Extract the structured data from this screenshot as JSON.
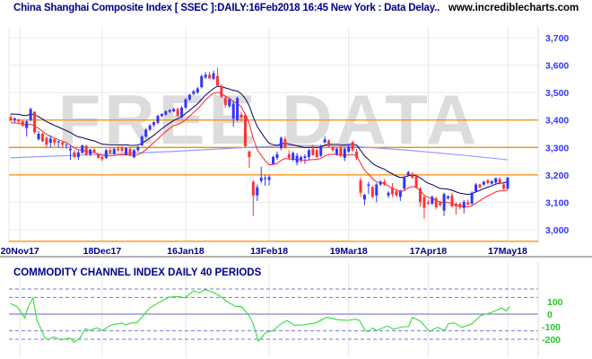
{
  "header": {
    "title": "China Shanghai Composite Index [ SSEC ]:DAILY:16Feb2018 16:45 New York : Data Delay..",
    "site": "www.incrediblecharts.com"
  },
  "watermark": "FREE DATA",
  "colors": {
    "up": "#3333ff",
    "down": "#ff3333",
    "fast_band": "#ff2222",
    "slow_band": "#000066",
    "long_ma": "#9999ff",
    "level": "#ff8800",
    "cci": "#33dd33",
    "axis_price": "#3333ff",
    "axis_cci": "#22cc22",
    "title": "#00008b"
  },
  "chart_data": [
    {
      "type": "candlestick",
      "title": "China Shanghai Composite Index [ SSEC ] DAILY",
      "ylim": [
        2940,
        3760
      ],
      "y_ticks": [
        {
          "v": 3000,
          "label": "3,000"
        },
        {
          "v": 3100,
          "label": "3,100"
        },
        {
          "v": 3200,
          "label": "3,200"
        },
        {
          "v": 3300,
          "label": "3,300"
        },
        {
          "v": 3400,
          "label": "3,400"
        },
        {
          "v": 3500,
          "label": "3,500"
        },
        {
          "v": 3600,
          "label": "3,600"
        },
        {
          "v": 3700,
          "label": "3,700"
        }
      ],
      "x_ticks": [
        {
          "day": 2.3,
          "label": "20Nov17"
        },
        {
          "day": 23,
          "label": "18Dec17"
        },
        {
          "day": 44,
          "label": "16Jan18"
        },
        {
          "day": 65,
          "label": "13Feb18"
        },
        {
          "day": 85,
          "label": "19Mar18"
        },
        {
          "day": 105,
          "label": "17Apr18"
        },
        {
          "day": 125,
          "label": "17May18"
        }
      ],
      "levels": [
        3400,
        3300,
        3200,
        2958
      ],
      "band_period": 13,
      "long_ma": [
        [
          0,
          3262
        ],
        [
          40,
          3285
        ],
        [
          70,
          3308
        ],
        [
          85,
          3305
        ],
        [
          100,
          3290
        ],
        [
          115,
          3270
        ],
        [
          125,
          3255
        ]
      ],
      "ohlc": [
        [
          3410,
          3420,
          3395,
          3400
        ],
        [
          3400,
          3410,
          3390,
          3405
        ],
        [
          3400,
          3405,
          3385,
          3395
        ],
        [
          3395,
          3400,
          3375,
          3380
        ],
        [
          3370,
          3400,
          3340,
          3395
        ],
        [
          3400,
          3445,
          3395,
          3440
        ],
        [
          3430,
          3432,
          3350,
          3355
        ],
        [
          3330,
          3360,
          3325,
          3350
        ],
        [
          3350,
          3355,
          3320,
          3322
        ],
        [
          3335,
          3340,
          3300,
          3310
        ],
        [
          3318,
          3345,
          3300,
          3332
        ],
        [
          3330,
          3335,
          3305,
          3318
        ],
        [
          3318,
          3325,
          3300,
          3322
        ],
        [
          3318,
          3320,
          3300,
          3310
        ],
        [
          3308,
          3312,
          3295,
          3311
        ],
        [
          3290,
          3310,
          3255,
          3295
        ],
        [
          3282,
          3290,
          3262,
          3265
        ],
        [
          3265,
          3290,
          3255,
          3282
        ],
        [
          3280,
          3310,
          3278,
          3308
        ],
        [
          3306,
          3310,
          3270,
          3272
        ],
        [
          3275,
          3295,
          3268,
          3292
        ],
        [
          3292,
          3296,
          3280,
          3283
        ],
        [
          3275,
          3280,
          3260,
          3262
        ],
        [
          3265,
          3268,
          3250,
          3257
        ],
        [
          3262,
          3295,
          3258,
          3290
        ],
        [
          3290,
          3300,
          3275,
          3280
        ],
        [
          3278,
          3300,
          3270,
          3295
        ],
        [
          3296,
          3305,
          3285,
          3290
        ],
        [
          3298,
          3305,
          3282,
          3288
        ],
        [
          3275,
          3300,
          3270,
          3298
        ],
        [
          3295,
          3300,
          3268,
          3272
        ],
        [
          3265,
          3295,
          3260,
          3290
        ],
        [
          3290,
          3305,
          3285,
          3302
        ],
        [
          3308,
          3345,
          3305,
          3340
        ],
        [
          3340,
          3370,
          3335,
          3365
        ],
        [
          3365,
          3385,
          3360,
          3380
        ],
        [
          3382,
          3395,
          3375,
          3392
        ],
        [
          3390,
          3420,
          3385,
          3415
        ],
        [
          3415,
          3425,
          3410,
          3422
        ],
        [
          3420,
          3435,
          3415,
          3432
        ],
        [
          3430,
          3440,
          3425,
          3436
        ],
        [
          3432,
          3445,
          3428,
          3440
        ],
        [
          3440,
          3445,
          3410,
          3415
        ],
        [
          3410,
          3450,
          3405,
          3445
        ],
        [
          3445,
          3480,
          3440,
          3475
        ],
        [
          3475,
          3495,
          3470,
          3492
        ],
        [
          3495,
          3510,
          3490,
          3505
        ],
        [
          3500,
          3520,
          3495,
          3515
        ],
        [
          3520,
          3565,
          3515,
          3560
        ],
        [
          3555,
          3575,
          3550,
          3565
        ],
        [
          3565,
          3575,
          3550,
          3552
        ],
        [
          3550,
          3580,
          3545,
          3570
        ],
        [
          3560,
          3590,
          3520,
          3525
        ],
        [
          3525,
          3530,
          3480,
          3485
        ],
        [
          3480,
          3490,
          3445,
          3455
        ],
        [
          3450,
          3480,
          3445,
          3475
        ],
        [
          3405,
          3470,
          3375,
          3460
        ],
        [
          3400,
          3485,
          3395,
          3480
        ],
        [
          3420,
          3430,
          3395,
          3410
        ],
        [
          3418,
          3425,
          3300,
          3305
        ],
        [
          3285,
          3290,
          3225,
          3265
        ],
        [
          3175,
          3180,
          3050,
          3125
        ],
        [
          3125,
          3165,
          3105,
          3155
        ],
        [
          3178,
          3230,
          3170,
          3190
        ],
        [
          3185,
          3200,
          3160,
          3188
        ],
        [
          3182,
          3200,
          3162,
          3192
        ],
        [
          3240,
          3270,
          3238,
          3265
        ],
        [
          3262,
          3285,
          3255,
          3275
        ],
        [
          3297,
          3340,
          3290,
          3335
        ],
        [
          3330,
          3340,
          3295,
          3300
        ],
        [
          3275,
          3290,
          3255,
          3262
        ],
        [
          3255,
          3285,
          3250,
          3280
        ],
        [
          3245,
          3280,
          3235,
          3270
        ],
        [
          3255,
          3270,
          3245,
          3265
        ],
        [
          3262,
          3275,
          3240,
          3268
        ],
        [
          3265,
          3295,
          3255,
          3290
        ],
        [
          3295,
          3310,
          3270,
          3272
        ],
        [
          3290,
          3295,
          3260,
          3265
        ],
        [
          3270,
          3310,
          3265,
          3302
        ],
        [
          3318,
          3340,
          3315,
          3330
        ],
        [
          3325,
          3330,
          3300,
          3305
        ],
        [
          3300,
          3305,
          3285,
          3290
        ],
        [
          3275,
          3300,
          3270,
          3295
        ],
        [
          3300,
          3310,
          3265,
          3270
        ],
        [
          3262,
          3300,
          3250,
          3295
        ],
        [
          3285,
          3310,
          3280,
          3302
        ],
        [
          3320,
          3325,
          3285,
          3290
        ],
        [
          3285,
          3295,
          3255,
          3262
        ],
        [
          3180,
          3190,
          3120,
          3135
        ],
        [
          3110,
          3130,
          3090,
          3128
        ],
        [
          3160,
          3175,
          3130,
          3165
        ],
        [
          3155,
          3160,
          3115,
          3120
        ],
        [
          3125,
          3170,
          3100,
          3165
        ],
        [
          3165,
          3180,
          3160,
          3175
        ],
        [
          3175,
          3185,
          3160,
          3165
        ],
        [
          3125,
          3140,
          3115,
          3135
        ],
        [
          3152,
          3170,
          3120,
          3130
        ],
        [
          3140,
          3150,
          3120,
          3125
        ],
        [
          3120,
          3145,
          3105,
          3142
        ],
        [
          3150,
          3195,
          3145,
          3190
        ],
        [
          3200,
          3215,
          3195,
          3210
        ],
        [
          3205,
          3210,
          3185,
          3190
        ],
        [
          3195,
          3200,
          3150,
          3155
        ],
        [
          3150,
          3155,
          3085,
          3100
        ],
        [
          3120,
          3125,
          3040,
          3080
        ],
        [
          3100,
          3110,
          3090,
          3095
        ],
        [
          3095,
          3125,
          3090,
          3120
        ],
        [
          3115,
          3120,
          3075,
          3082
        ],
        [
          3100,
          3105,
          3085,
          3090
        ],
        [
          3070,
          3135,
          3050,
          3130
        ],
        [
          3115,
          3125,
          3110,
          3122
        ],
        [
          3125,
          3135,
          3080,
          3085
        ],
        [
          3095,
          3100,
          3055,
          3085
        ],
        [
          3095,
          3100,
          3075,
          3082
        ],
        [
          3080,
          3108,
          3060,
          3102
        ],
        [
          3100,
          3110,
          3090,
          3092
        ],
        [
          3095,
          3140,
          3090,
          3135
        ],
        [
          3140,
          3170,
          3135,
          3165
        ],
        [
          3165,
          3168,
          3150,
          3155
        ],
        [
          3165,
          3178,
          3160,
          3175
        ],
        [
          3180,
          3185,
          3165,
          3170
        ],
        [
          3168,
          3180,
          3165,
          3177
        ],
        [
          3172,
          3190,
          3168,
          3188
        ],
        [
          3185,
          3192,
          3165,
          3170
        ],
        [
          3165,
          3175,
          3145,
          3150
        ],
        [
          3150,
          3192,
          3145,
          3190
        ]
      ]
    },
    {
      "type": "line",
      "title": "COMMODITY CHANNEL INDEX DAILY 40 PERIODS",
      "ylim": [
        -260,
        260
      ],
      "y_ticks": [
        {
          "v": 100,
          "label": "100"
        },
        {
          "v": 0,
          "label": "0"
        },
        {
          "v": -100,
          "label": "-100"
        },
        {
          "v": -200,
          "label": "-200"
        }
      ],
      "dashed_levels": [
        200,
        133,
        -133,
        -200
      ],
      "series": [
        [
          0,
          84
        ],
        [
          1.6,
          60
        ],
        [
          3.5,
          -30
        ],
        [
          4.4,
          60
        ],
        [
          5.6,
          130
        ],
        [
          6.5,
          -40
        ],
        [
          8.6,
          -190
        ],
        [
          9.5,
          -205
        ],
        [
          10.7,
          -180
        ],
        [
          12.6,
          -205
        ],
        [
          15,
          -190
        ],
        [
          15.9,
          -225
        ],
        [
          17.4,
          -190
        ],
        [
          18.8,
          -115
        ],
        [
          19.8,
          -130
        ],
        [
          21.7,
          -110
        ],
        [
          23.1,
          -130
        ],
        [
          25,
          -90
        ],
        [
          27.9,
          -70
        ],
        [
          28.8,
          -85
        ],
        [
          30.3,
          -70
        ],
        [
          31.7,
          -70
        ],
        [
          33.6,
          0
        ],
        [
          35,
          50
        ],
        [
          37.4,
          95
        ],
        [
          39.8,
          135
        ],
        [
          42.2,
          140
        ],
        [
          43.7,
          130
        ],
        [
          46,
          185
        ],
        [
          47.5,
          170
        ],
        [
          48.9,
          195
        ],
        [
          50.8,
          175
        ],
        [
          52.8,
          140
        ],
        [
          54.7,
          95
        ],
        [
          56.6,
          60
        ],
        [
          58,
          60
        ],
        [
          59.9,
          -10
        ],
        [
          60.9,
          -70
        ],
        [
          62.3,
          -215
        ],
        [
          64.2,
          -145
        ],
        [
          66.1,
          -130
        ],
        [
          67.6,
          -85
        ],
        [
          69.5,
          -50
        ],
        [
          71.4,
          -90
        ],
        [
          73.8,
          -85
        ],
        [
          76.7,
          -70
        ],
        [
          79.5,
          -25
        ],
        [
          82.4,
          -45
        ],
        [
          84.8,
          -50
        ],
        [
          86.7,
          -40
        ],
        [
          87.7,
          -50
        ],
        [
          89.1,
          -130
        ],
        [
          90,
          -140
        ],
        [
          91,
          -110
        ],
        [
          92,
          -130
        ],
        [
          94.8,
          -95
        ],
        [
          96.3,
          -120
        ],
        [
          98.7,
          -100
        ],
        [
          100.1,
          -100
        ],
        [
          101,
          -25
        ],
        [
          103,
          -55
        ],
        [
          105.4,
          -140
        ],
        [
          107.3,
          -105
        ],
        [
          109.2,
          -130
        ],
        [
          110.1,
          -75
        ],
        [
          111.6,
          -70
        ],
        [
          113.5,
          -105
        ],
        [
          115.9,
          -80
        ],
        [
          118.3,
          -10
        ],
        [
          120.7,
          10
        ],
        [
          123.5,
          50
        ],
        [
          124.6,
          25
        ],
        [
          125.5,
          60
        ]
      ]
    }
  ]
}
